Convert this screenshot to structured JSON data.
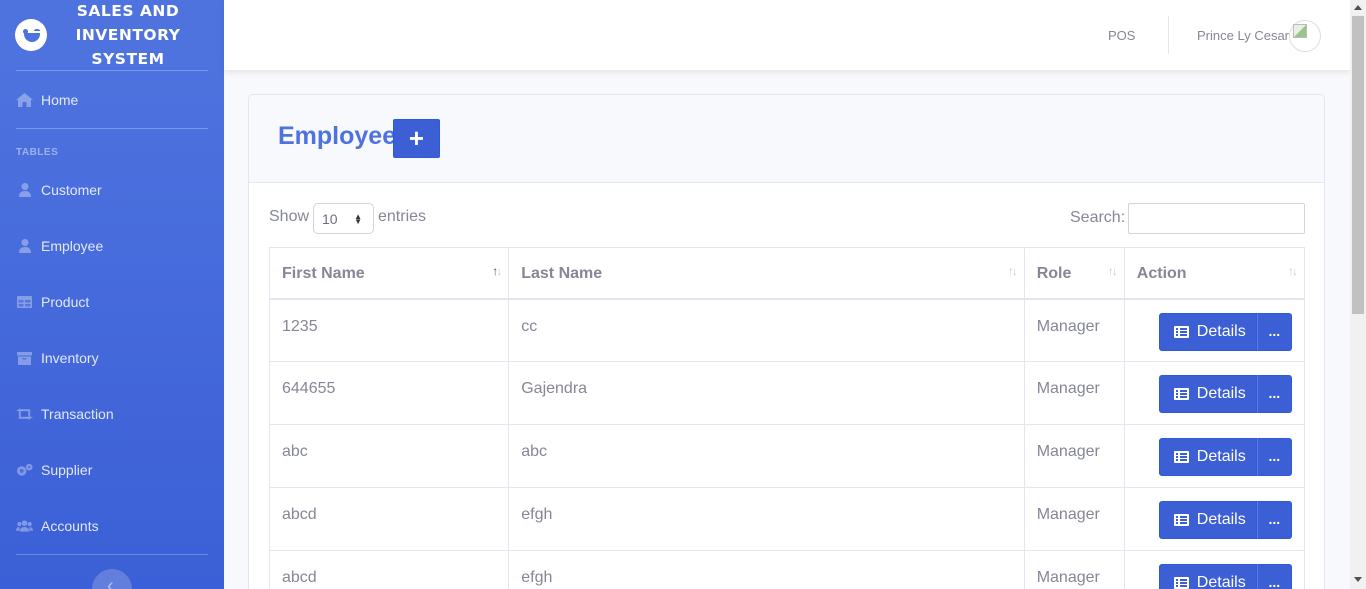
{
  "brand": {
    "title": "SALES AND\nINVENTORY\nSYSTEM"
  },
  "sidebar": {
    "home": "Home",
    "heading": "TABLES",
    "items": [
      {
        "label": "Customer",
        "icon": "user-icon"
      },
      {
        "label": "Employee",
        "icon": "user-icon"
      },
      {
        "label": "Product",
        "icon": "table-icon"
      },
      {
        "label": "Inventory",
        "icon": "archive-icon"
      },
      {
        "label": "Transaction",
        "icon": "retweet-icon"
      },
      {
        "label": "Supplier",
        "icon": "cogs-icon"
      },
      {
        "label": "Accounts",
        "icon": "users-icon"
      }
    ]
  },
  "topbar": {
    "pos": "POS",
    "user": "Prince Ly Cesar"
  },
  "card": {
    "title": "Employee"
  },
  "table_controls": {
    "show": "Show",
    "page_size": "10",
    "entries": "entries",
    "search": "Search:"
  },
  "table": {
    "columns": [
      "First Name",
      "Last Name",
      "Role",
      "Action"
    ],
    "rows": [
      {
        "first": "1235",
        "last": "cc",
        "role": "Manager"
      },
      {
        "first": "644655",
        "last": "Gajendra",
        "role": "Manager"
      },
      {
        "first": "abc",
        "last": "abc",
        "role": "Manager"
      },
      {
        "first": "abcd",
        "last": "efgh",
        "role": "Manager"
      },
      {
        "first": "abcd",
        "last": "efgh",
        "role": "Manager"
      }
    ],
    "details_label": "Details",
    "more_label": "..."
  }
}
